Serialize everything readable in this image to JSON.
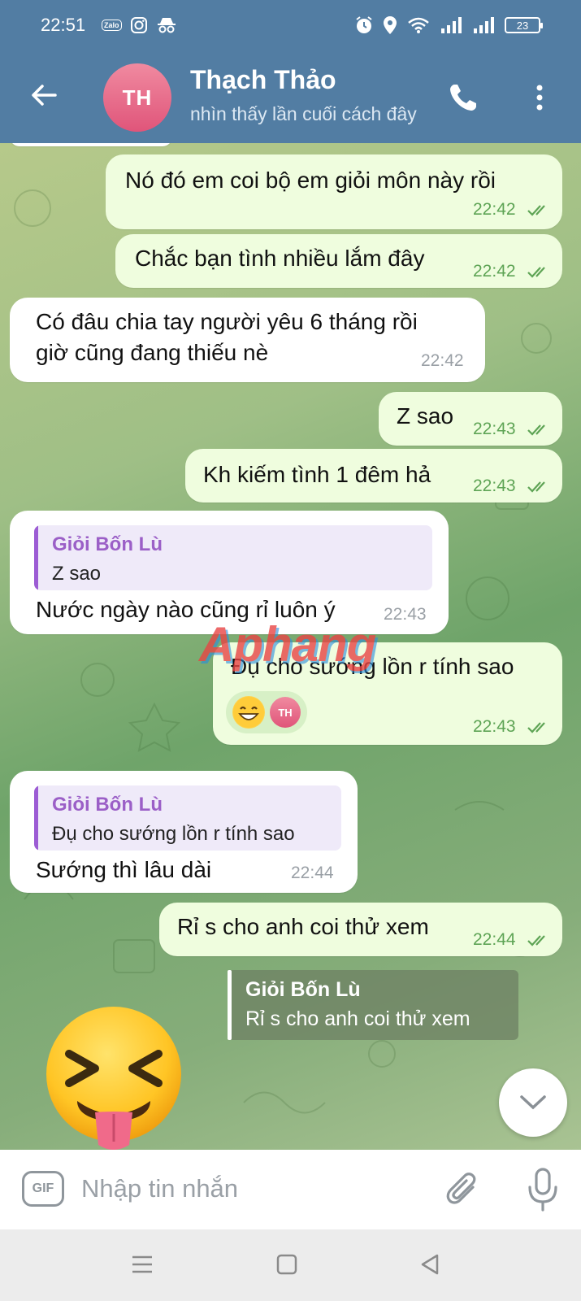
{
  "status_bar": {
    "time": "22:51",
    "battery": "23",
    "zalo_label": "Zalo"
  },
  "header": {
    "avatar_initials": "TH",
    "contact_name": "Thạch Thảo",
    "contact_status": "nhìn thấy lần cuối cách đây"
  },
  "messages": [
    {
      "text": "Nó đó em coi bộ em giỏi môn này rồi",
      "time": "22:42"
    },
    {
      "text": "Chắc bạn tình nhiều lắm đây",
      "time": "22:42"
    },
    {
      "lines": [
        "Có đâu chia tay người yêu 6 tháng rồi",
        "giờ cũng đang thiếu nè"
      ],
      "time": "22:42"
    },
    {
      "text": "Z sao",
      "time": "22:43"
    },
    {
      "text": "Kh kiếm tình 1 đêm hả",
      "time": "22:43"
    },
    {
      "quote_name": "Giỏi Bốn Lù",
      "quote_text": "Z sao",
      "text": "Nước ngày nào cũng rỉ luôn ý",
      "time": "22:43"
    },
    {
      "text": "Đụ cho sướng lồn r tính sao",
      "time": "22:43",
      "reaction": "😁",
      "reaction_avatar": "TH"
    },
    {
      "quote_name": "Giỏi Bốn Lù",
      "quote_text": "Đụ cho sướng lồn r tính sao",
      "text": "Sướng thì lâu dài",
      "time": "22:44"
    },
    {
      "text": "Rỉ s cho anh coi thử xem",
      "time": "22:44"
    }
  ],
  "reply_preview": {
    "name": "Giỏi Bốn Lù",
    "text": "Rỉ s cho anh coi thử xem"
  },
  "watermark": "Aphang",
  "composer": {
    "gif_label": "GIF",
    "placeholder": "Nhập tin nhắn"
  },
  "colors": {
    "header": "#527da3",
    "outgoing_bubble": "#effdde",
    "incoming_bubble": "#ffffff",
    "quote_accent": "#9c5cd4",
    "time_out": "#5ea455"
  }
}
